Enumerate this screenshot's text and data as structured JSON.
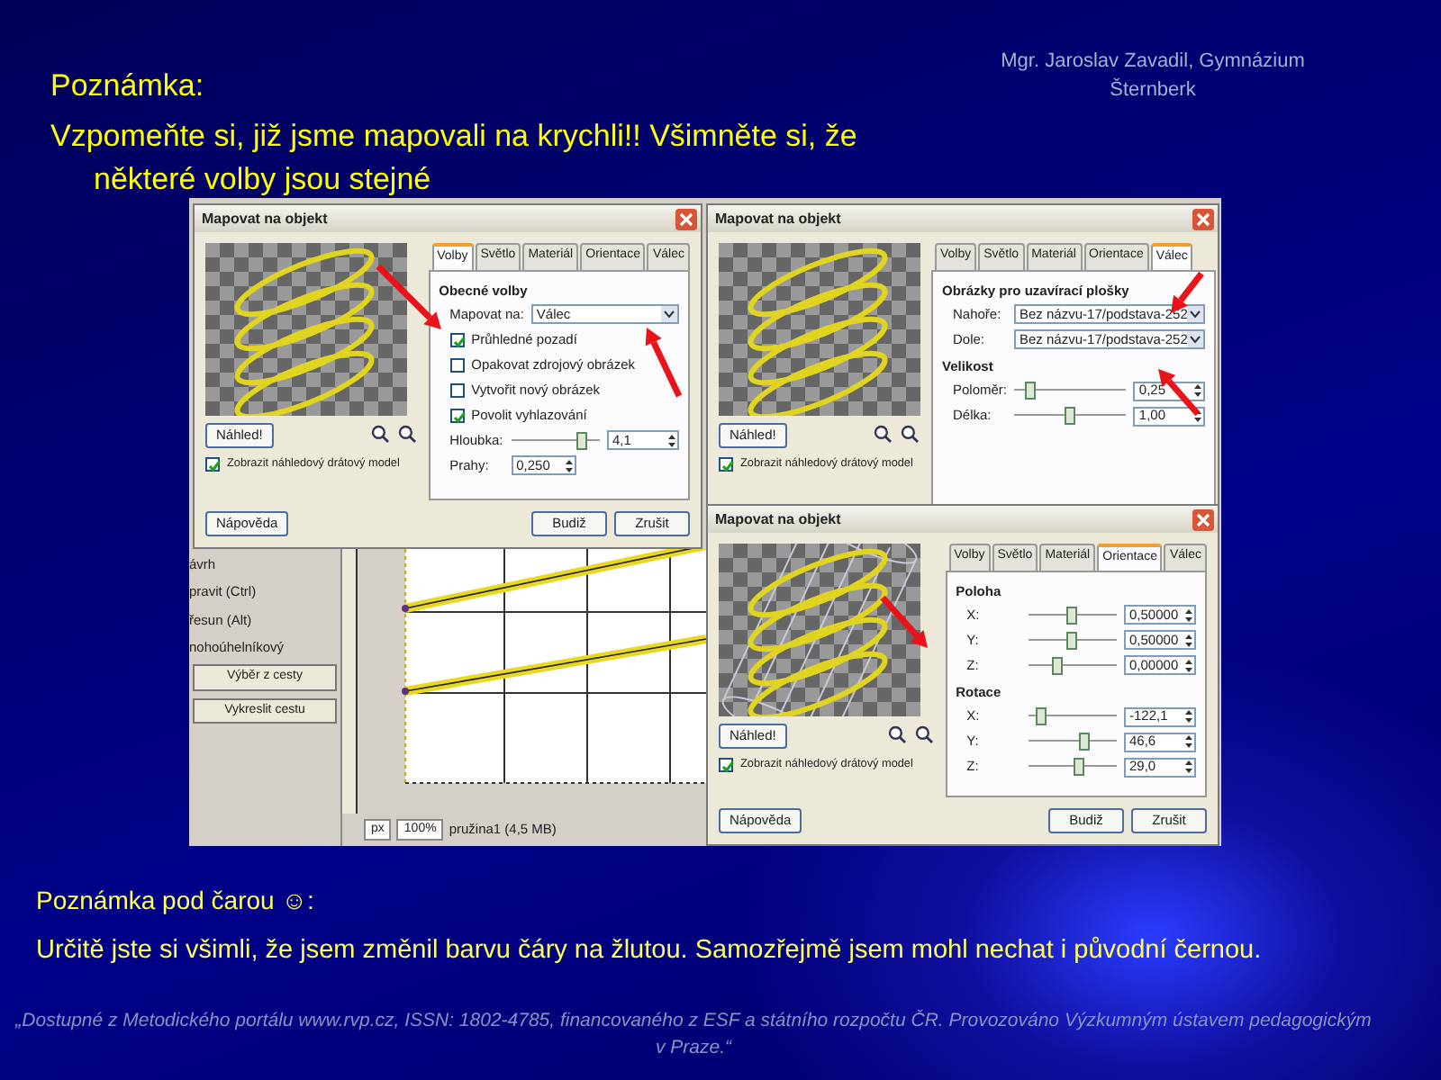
{
  "author": "Mgr. Jaroslav Zavadil, Gymnázium Šternberk",
  "title": "Poznámka:",
  "intro": "Vzpomeňte si, již jsme mapovali na krychli!! Všimněte si, že některé volby jsou stejné",
  "background_window": {
    "tool_options": [
      "ávrh",
      "pravit (Ctrl)",
      "řesun (Alt)",
      "nohoúhelníkový"
    ],
    "buttons": [
      "Výběr z cesty",
      "Vykreslit cestu"
    ],
    "unit": "px",
    "zoom": "100%",
    "status": "pružina1 (4,5 MB)"
  },
  "dialogs": [
    {
      "title": "Mapovat na objekt",
      "kind": "spring",
      "preview_button": "Náhled!",
      "wireframe": {
        "label": "Zobrazit náhledový drátový model",
        "checked": true
      },
      "tabs": [
        {
          "label": "Volby",
          "selected": true
        },
        {
          "label": "Světlo",
          "selected": false
        },
        {
          "label": "Materiál",
          "selected": false
        },
        {
          "label": "Orientace",
          "selected": false
        },
        {
          "label": "Válec",
          "selected": false
        }
      ],
      "sections": [
        {
          "heading": "Obecné volby",
          "rows": [
            {
              "kind": "dropdown",
              "label": "Mapovat na:",
              "value": "Válec"
            },
            {
              "kind": "checkbox",
              "label": "Průhledné pozadí",
              "checked": true
            },
            {
              "kind": "checkbox",
              "label": "Opakovat zdrojový obrázek",
              "checked": false
            },
            {
              "kind": "checkbox",
              "label": "Vytvořit nový obrázek",
              "checked": false
            },
            {
              "kind": "checkbox",
              "label": "Povolit vyhlazování",
              "checked": true
            },
            {
              "kind": "slider",
              "label": "Hloubka:",
              "level": 0.8,
              "value": "4,1"
            },
            {
              "kind": "spin",
              "label": "Prahy:",
              "value": "0,250"
            }
          ]
        }
      ],
      "buttons": [
        "Nápověda",
        "Budiž",
        "Zrušit"
      ]
    },
    {
      "title": "Mapovat na objekt",
      "kind": "spring",
      "preview_button": "Náhled!",
      "wireframe": {
        "label": "Zobrazit náhledový drátový model",
        "checked": true
      },
      "tabs": [
        {
          "label": "Volby",
          "selected": false
        },
        {
          "label": "Světlo",
          "selected": false
        },
        {
          "label": "Materiál",
          "selected": false
        },
        {
          "label": "Orientace",
          "selected": false
        },
        {
          "label": "Válec",
          "selected": true
        }
      ],
      "sections": [
        {
          "heading": "Obrázky pro uzavírací plošky",
          "rows": [
            {
              "kind": "dropdown",
              "label": "Nahoře:",
              "value": "Bez názvu-17/podstava-252"
            },
            {
              "kind": "dropdown",
              "label": "Dole:",
              "value": "Bez názvu-17/podstava-252"
            }
          ]
        },
        {
          "heading": "Velikost",
          "rows": [
            {
              "kind": "slider",
              "label": "Poloměr:",
              "level": 0.15,
              "value": "0,25"
            },
            {
              "kind": "slider",
              "label": "Délka:",
              "level": 0.5,
              "value": "1,00"
            }
          ]
        }
      ]
    },
    {
      "title": "Mapovat na objekt",
      "kind": "wireframe",
      "preview_button": "Náhled!",
      "wireframe": {
        "label": "Zobrazit náhledový drátový model",
        "checked": true
      },
      "tabs": [
        {
          "label": "Volby",
          "selected": false
        },
        {
          "label": "Světlo",
          "selected": false
        },
        {
          "label": "Materiál",
          "selected": false
        },
        {
          "label": "Orientace",
          "selected": true
        },
        {
          "label": "Válec",
          "selected": false
        }
      ],
      "sections": [
        {
          "heading": "Poloha",
          "rows": [
            {
              "kind": "slider",
              "label": "X:",
              "level": 0.5,
              "value": "0,50000"
            },
            {
              "kind": "slider",
              "label": "Y:",
              "level": 0.5,
              "value": "0,50000"
            },
            {
              "kind": "slider",
              "label": "Z:",
              "level": 0.33,
              "value": "0,00000"
            }
          ]
        },
        {
          "heading": "Rotace",
          "rows": [
            {
              "kind": "slider",
              "label": "X:",
              "level": 0.15,
              "value": "-122,1"
            },
            {
              "kind": "slider",
              "label": "Y:",
              "level": 0.63,
              "value": "46,6"
            },
            {
              "kind": "slider",
              "label": "Z:",
              "level": 0.58,
              "value": "29,0"
            }
          ]
        }
      ],
      "buttons": [
        "Nápověda",
        "Budiž",
        "Zrušit"
      ]
    }
  ],
  "footnote_title": "Poznámka pod čarou ☺:",
  "footnote": "Určitě jste si všimli, že jsem změnil barvu čáry na žlutou. Samozřejmě jsem mohl nechat i původní černou.",
  "citation": "„Dostupné z Metodického portálu www.rvp.cz, ISSN: 1802-4785, financovaného z ESF a státního rozpočtu ČR. Provozováno Výzkumným ústavem pedagogickým v Praze.“"
}
